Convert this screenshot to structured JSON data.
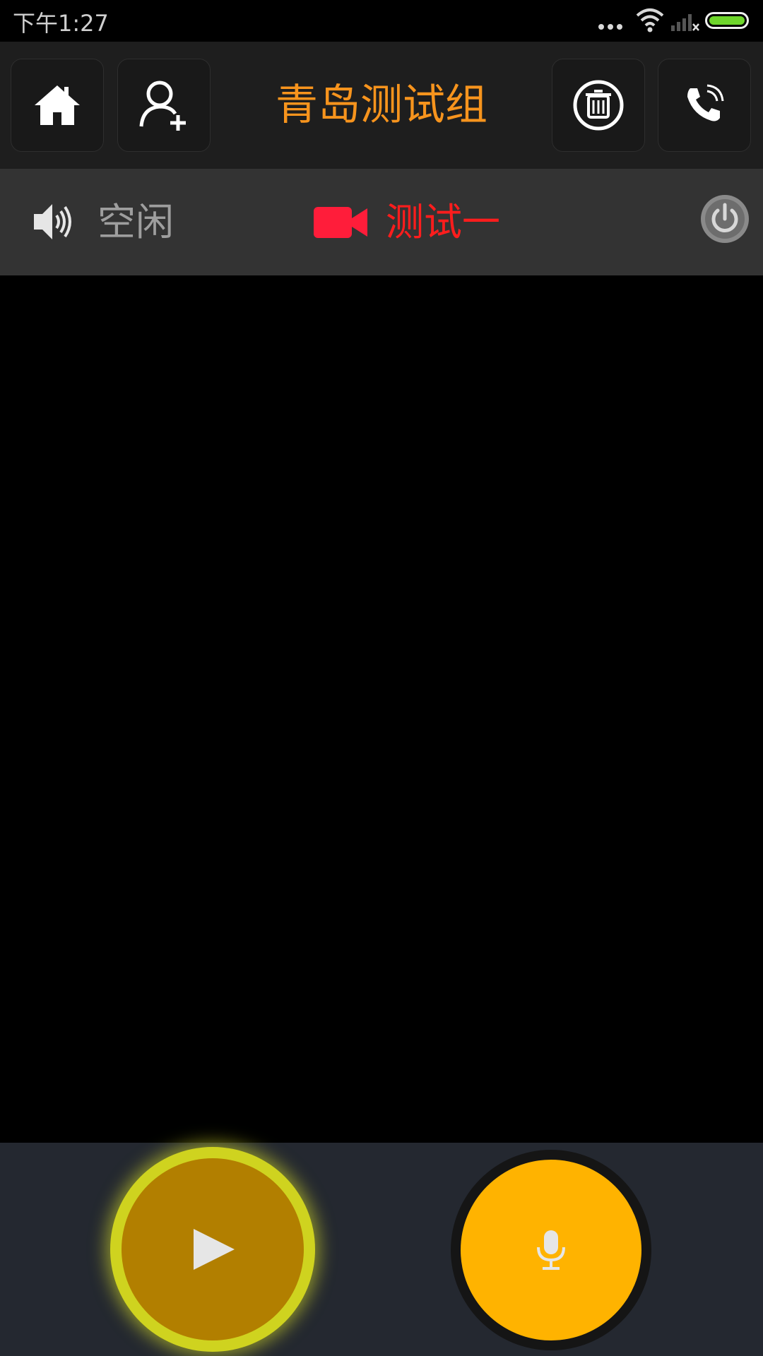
{
  "status_bar": {
    "time": "下午1:27",
    "icons": [
      "more-dots-icon",
      "wifi-icon",
      "no-signal-icon",
      "battery-icon"
    ],
    "battery_color": "#6ed62b"
  },
  "toolbar": {
    "title": "青岛测试组",
    "title_color": "#f7941d",
    "buttons": [
      "home-icon",
      "add-user-icon",
      "trash-icon",
      "phone-call-icon"
    ]
  },
  "channel_status": {
    "audio_status": "空闲",
    "channel_name": "测试一",
    "channel_color": "#ff1d1d",
    "icons": [
      "speaker-icon",
      "video-camera-icon",
      "power-icon"
    ]
  },
  "controls": {
    "play_button_icon": "play-icon",
    "mic_button_icon": "microphone-icon",
    "play_color": "#b27f00",
    "mic_color": "#ffb300"
  }
}
